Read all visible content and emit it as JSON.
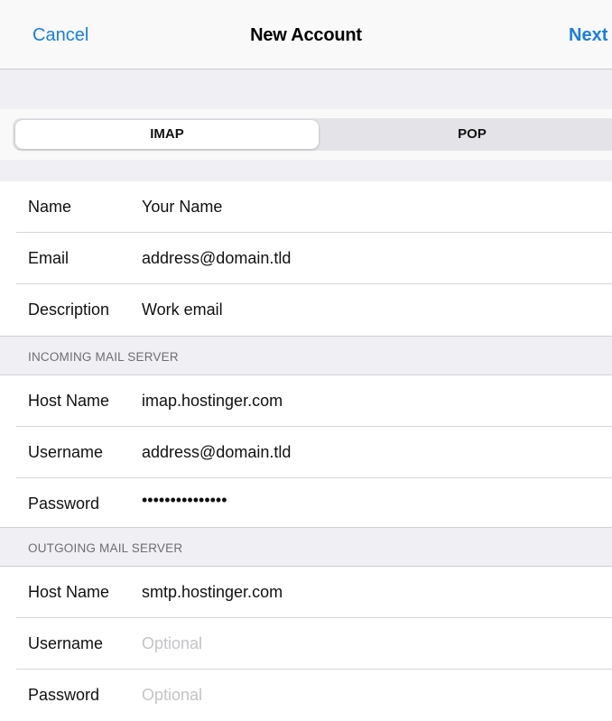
{
  "navbar": {
    "cancel_label": "Cancel",
    "title": "New Account",
    "next_label": "Next"
  },
  "account_type": {
    "options": [
      "IMAP",
      "POP"
    ],
    "selected": "IMAP"
  },
  "account": {
    "rows": [
      {
        "label": "Name",
        "value": "Your Name"
      },
      {
        "label": "Email",
        "value": "address@domain.tld"
      },
      {
        "label": "Description",
        "value": "Work email"
      }
    ]
  },
  "incoming": {
    "header": "INCOMING MAIL SERVER",
    "rows": [
      {
        "label": "Host Name",
        "value": "imap.hostinger.com"
      },
      {
        "label": "Username",
        "value": "address@domain.tld"
      },
      {
        "label": "Password",
        "value": "•••••••••••••••"
      }
    ]
  },
  "outgoing": {
    "header": "OUTGOING MAIL SERVER",
    "rows": [
      {
        "label": "Host Name",
        "value": "smtp.hostinger.com"
      },
      {
        "label": "Username",
        "placeholder": "Optional"
      },
      {
        "label": "Password",
        "placeholder": "Optional"
      }
    ]
  },
  "colors": {
    "accent": "#1a7ee0",
    "grouped_background": "#efeff4",
    "placeholder": "#c4c4c8",
    "section_header_text": "#6d6d72"
  }
}
